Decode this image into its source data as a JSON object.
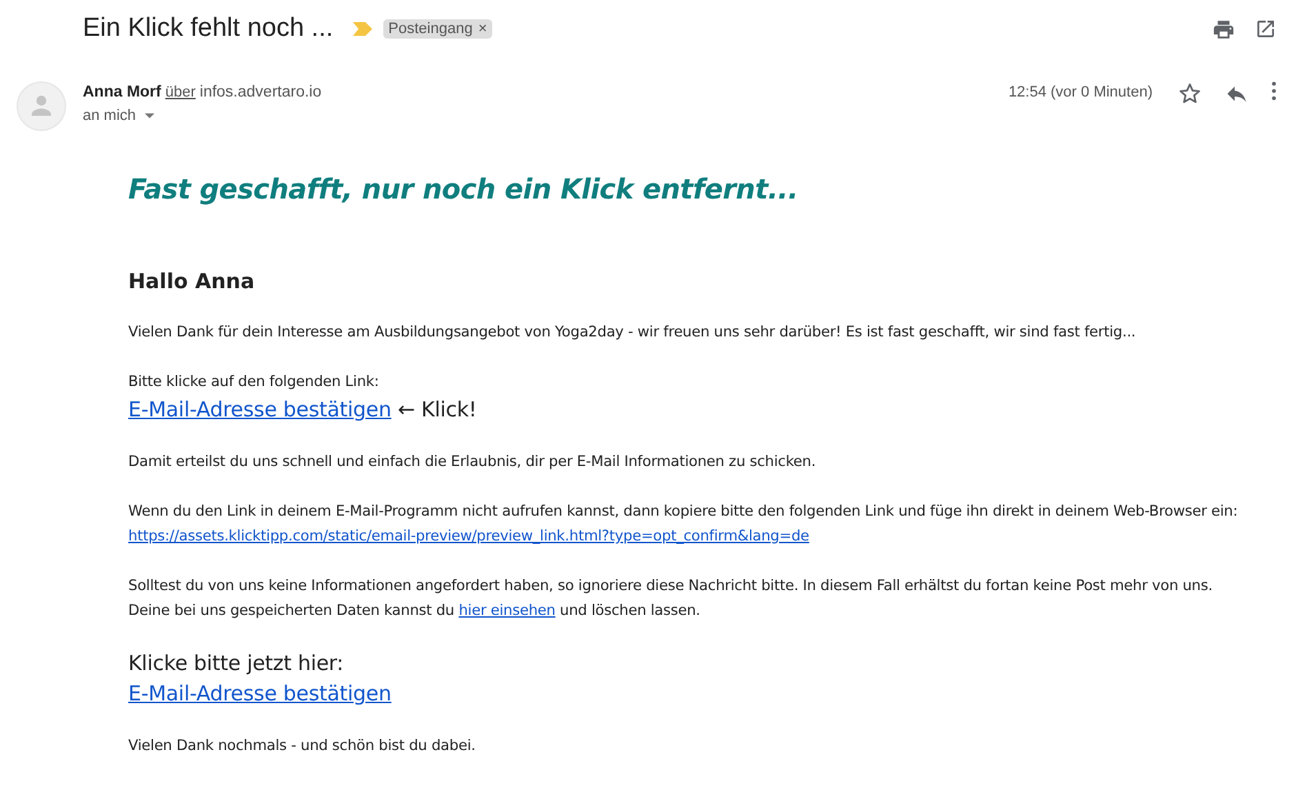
{
  "subject": "Ein Klick fehlt noch ...",
  "important": true,
  "label": {
    "text": "Posteingang",
    "close": "×"
  },
  "sender": {
    "name": "Anna Morf",
    "via": "über",
    "domain": "infos.advertaro.io",
    "to": "an mich",
    "time": "12:54 (vor 0 Minuten)",
    "starred": false
  },
  "body": [
    {
      "kind": "headline",
      "text": "Fast geschafft, nur noch ein Klick entfernt..."
    },
    {
      "kind": "greeting",
      "text": "Hallo Anna"
    },
    {
      "kind": "paragraph",
      "lines": [
        {
          "kind": "normal",
          "segments": [
            {
              "kind": "text",
              "text": "Vielen Dank für dein Interesse am Ausbildungsangebot von Yoga2day - wir freuen uns sehr darüber! Es ist fast geschafft, wir sind fast fertig..."
            }
          ]
        }
      ]
    },
    {
      "kind": "paragraph",
      "lines": [
        {
          "kind": "normal",
          "segments": [
            {
              "kind": "text",
              "text": "Bitte klicke auf den folgenden Link:"
            }
          ]
        },
        {
          "kind": "large",
          "segments": [
            {
              "kind": "link",
              "text": "E-Mail-Adresse bestätigen"
            },
            {
              "kind": "text",
              "text": " ← Klick!"
            }
          ]
        }
      ]
    },
    {
      "kind": "paragraph",
      "lines": [
        {
          "kind": "normal",
          "segments": [
            {
              "kind": "text",
              "text": "Damit erteilst du uns schnell und einfach die Erlaubnis, dir per E-Mail Informationen zu schicken."
            }
          ]
        }
      ]
    },
    {
      "kind": "paragraph",
      "lines": [
        {
          "kind": "normal",
          "segments": [
            {
              "kind": "text",
              "text": "Wenn du den Link in deinem E-Mail-Programm nicht aufrufen kannst, dann kopiere bitte den folgenden Link und füge ihn direkt in deinem Web-Browser ein:"
            }
          ]
        },
        {
          "kind": "normal",
          "segments": [
            {
              "kind": "link",
              "text": "https://assets.klicktipp.com/static/email-preview/preview_link.html?type=opt_confirm&lang=de"
            }
          ]
        }
      ]
    },
    {
      "kind": "paragraph",
      "lines": [
        {
          "kind": "normal",
          "segments": [
            {
              "kind": "text",
              "text": "Solltest du von uns keine Informationen angefordert haben, so ignoriere diese Nachricht bitte. In diesem Fall erhältst du fortan keine Post mehr von uns."
            }
          ]
        },
        {
          "kind": "normal",
          "segments": [
            {
              "kind": "text",
              "text": "Deine bei uns gespeicherten Daten kannst du "
            },
            {
              "kind": "link",
              "text": "hier einsehen"
            },
            {
              "kind": "text",
              "text": " und löschen lassen."
            }
          ]
        }
      ]
    },
    {
      "kind": "paragraph",
      "lines": [
        {
          "kind": "large",
          "segments": [
            {
              "kind": "text",
              "text": "Klicke bitte jetzt hier:"
            }
          ]
        },
        {
          "kind": "large",
          "segments": [
            {
              "kind": "link",
              "text": "E-Mail-Adresse bestätigen"
            }
          ]
        }
      ]
    },
    {
      "kind": "paragraph",
      "lines": [
        {
          "kind": "normal",
          "segments": [
            {
              "kind": "text",
              "text": "Vielen Dank nochmals - und schön bist du dabei."
            }
          ]
        }
      ]
    }
  ]
}
